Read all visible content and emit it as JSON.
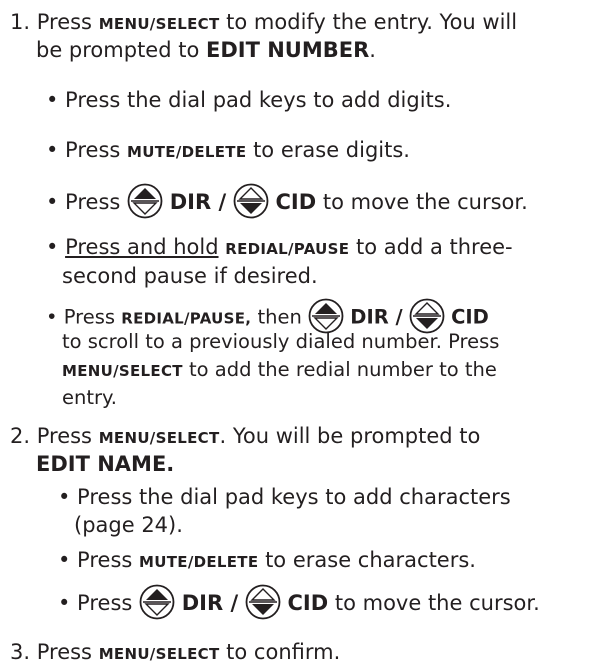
{
  "step1": {
    "num": "1.",
    "press": "Press",
    "key": "MENU/SELECT",
    "text": "to modify the entry. You will",
    "line2": "be prompted to",
    "prompt": "EDIT NUMBER",
    "period": ".",
    "bullets": {
      "b1": "• Press the dial pad keys to add digits.",
      "b2_pre": "• Press",
      "b2_key": "MUTE/DELETE",
      "b2_post": "to erase digits.",
      "b3_pre": "• Press",
      "b3_dir": "DIR /",
      "b3_cid": "CID",
      "b3_post": "to move the cursor.",
      "b4_bullet": "•",
      "b4_under": "Press and hold",
      "b4_key": "REDIAL/PAUSE",
      "b4_post": "to add a three-",
      "b4_line2": "second pause if desired.",
      "b5_pre": "• Press",
      "b5_key": "REDIAL/PAUSE,",
      "b5_mid": "then",
      "b5_dir": "DIR /",
      "b5_cid": "CID",
      "b5_line2": "to scroll to a previously dialed number. Press",
      "b5_key2": "MENU/SELECT",
      "b5_line3": "to add the redial number to the",
      "b5_line4": "entry."
    }
  },
  "step2": {
    "num": "2.",
    "press": "Press",
    "key": "MENU/SELECT",
    "text": ". You will be prompted to",
    "prompt": "EDIT NAME.",
    "bullets": {
      "b1": "• Press the dial pad keys to add characters",
      "b1_line2": "(page 24).",
      "b2_pre": "• Press",
      "b2_key": "MUTE/DELETE",
      "b2_post": "to erase characters.",
      "b3_pre": "• Press",
      "b3_dir": "DIR /",
      "b3_cid": "CID",
      "b3_post": "to move the cursor."
    }
  },
  "step3": {
    "num": "3.",
    "press": "Press",
    "key": "MENU/SELECT",
    "text": "to confirm."
  },
  "icons": {
    "up": "up-arrow-key-icon",
    "down": "down-arrow-key-icon"
  }
}
